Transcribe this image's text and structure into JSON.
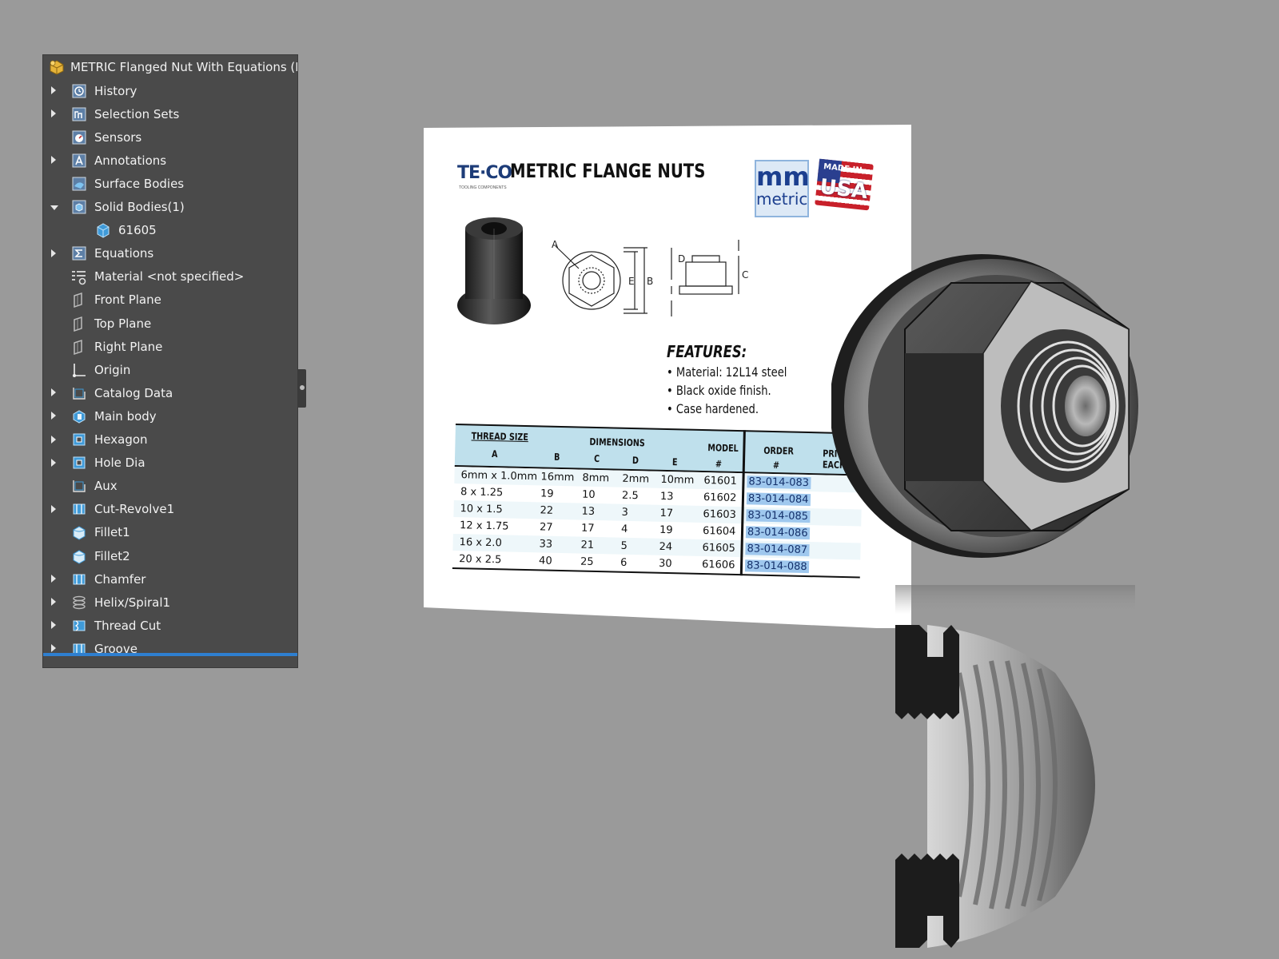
{
  "tree": {
    "root_label": "METRIC Flanged Nut With Equations  (De",
    "items": [
      {
        "label": "History",
        "expand": "collapsed",
        "indent": 0,
        "icon": "history-icon"
      },
      {
        "label": "Selection Sets",
        "expand": "collapsed",
        "indent": 0,
        "icon": "selection-sets-icon"
      },
      {
        "label": "Sensors",
        "expand": "none",
        "indent": 0,
        "icon": "sensors-icon"
      },
      {
        "label": "Annotations",
        "expand": "collapsed",
        "indent": 0,
        "icon": "annotations-icon"
      },
      {
        "label": "Surface Bodies",
        "expand": "none",
        "indent": 0,
        "icon": "surface-bodies-icon"
      },
      {
        "label": "Solid Bodies(1)",
        "expand": "expanded",
        "indent": 0,
        "icon": "solid-bodies-icon"
      },
      {
        "label": "61605",
        "expand": "none",
        "indent": 1,
        "icon": "solid-body-icon"
      },
      {
        "label": "Equations",
        "expand": "collapsed",
        "indent": 0,
        "icon": "equations-icon"
      },
      {
        "label": "Material <not specified>",
        "expand": "none",
        "indent": 0,
        "icon": "material-icon"
      },
      {
        "label": "Front Plane",
        "expand": "none",
        "indent": 0,
        "icon": "plane-icon"
      },
      {
        "label": "Top Plane",
        "expand": "none",
        "indent": 0,
        "icon": "plane-icon"
      },
      {
        "label": "Right Plane",
        "expand": "none",
        "indent": 0,
        "icon": "plane-icon"
      },
      {
        "label": "Origin",
        "expand": "none",
        "indent": 0,
        "icon": "origin-icon"
      },
      {
        "label": "Catalog Data",
        "expand": "collapsed",
        "indent": 0,
        "icon": "sketch-icon"
      },
      {
        "label": "Main body",
        "expand": "collapsed",
        "indent": 0,
        "icon": "boss-extrude-icon"
      },
      {
        "label": "Hexagon",
        "expand": "collapsed",
        "indent": 0,
        "icon": "cut-extrude-icon"
      },
      {
        "label": "Hole Dia",
        "expand": "collapsed",
        "indent": 0,
        "icon": "cut-extrude-icon"
      },
      {
        "label": "Aux",
        "expand": "none",
        "indent": 0,
        "icon": "sketch-icon"
      },
      {
        "label": "Cut-Revolve1",
        "expand": "collapsed",
        "indent": 0,
        "icon": "cut-revolve-icon"
      },
      {
        "label": "Fillet1",
        "expand": "none",
        "indent": 0,
        "icon": "fillet-icon"
      },
      {
        "label": "Fillet2",
        "expand": "none",
        "indent": 0,
        "icon": "fillet-icon"
      },
      {
        "label": "Chamfer",
        "expand": "collapsed",
        "indent": 0,
        "icon": "chamfer-icon"
      },
      {
        "label": "Helix/Spiral1",
        "expand": "collapsed",
        "indent": 0,
        "icon": "helix-icon"
      },
      {
        "label": "Thread Cut",
        "expand": "collapsed",
        "indent": 0,
        "icon": "thread-cut-icon"
      },
      {
        "label": "Groove",
        "expand": "collapsed",
        "indent": 0,
        "icon": "groove-icon"
      }
    ]
  },
  "sheet": {
    "logo": "TE·CO",
    "logo_sub": "TOOLING COMPONENTS",
    "title": "METRIC FLANGE NUTS",
    "mm_badge_big": "mm",
    "mm_badge_small": "metric",
    "usa_badge_top": "MADE IN",
    "usa_badge_bottom": "USA",
    "diagram_labels": [
      "A",
      "E",
      "B",
      "D",
      "C"
    ],
    "features_heading": "FEATURES:",
    "features": [
      "• Material: 12L14 steel",
      "• Black oxide finish.",
      "• Case hardened."
    ],
    "table": {
      "group_headers": {
        "thread_size": "THREAD SIZE",
        "dimensions": "DIMENSIONS",
        "model": "MODEL",
        "order": "ORDER",
        "price": "PRI EACH"
      },
      "sub_headers": {
        "a": "A",
        "b": "B",
        "c": "C",
        "d": "D",
        "e": "E",
        "model": "#",
        "order": "#"
      },
      "rows": [
        {
          "a": "6mm x 1.0mm",
          "b": "16mm",
          "c": "8mm",
          "d": "2mm",
          "e": "10mm",
          "model": "61601",
          "order": "83-014-083"
        },
        {
          "a": "8 x 1.25",
          "b": "19",
          "c": "10",
          "d": "2.5",
          "e": "13",
          "model": "61602",
          "order": "83-014-084"
        },
        {
          "a": "10 x 1.5",
          "b": "22",
          "c": "13",
          "d": "3",
          "e": "17",
          "model": "61603",
          "order": "83-014-085"
        },
        {
          "a": "12 x 1.75",
          "b": "27",
          "c": "17",
          "d": "4",
          "e": "19",
          "model": "61604",
          "order": "83-014-086"
        },
        {
          "a": "16 x 2.0",
          "b": "33",
          "c": "21",
          "d": "5",
          "e": "24",
          "model": "61605",
          "order": "83-014-087"
        },
        {
          "a": "20 x 2.5",
          "b": "40",
          "c": "25",
          "d": "6",
          "e": "30",
          "model": "61606",
          "order": "83-014-088"
        }
      ]
    }
  },
  "colors": {
    "background": "#9a9a9a",
    "tree_bg": "#4a4a4a",
    "tree_text": "#f2f2f2",
    "selection_bar": "#2e7fd0",
    "icon_blue": "#3f9ad8",
    "table_header": "#bfe0ec",
    "order_highlight": "#9fc8ee"
  }
}
